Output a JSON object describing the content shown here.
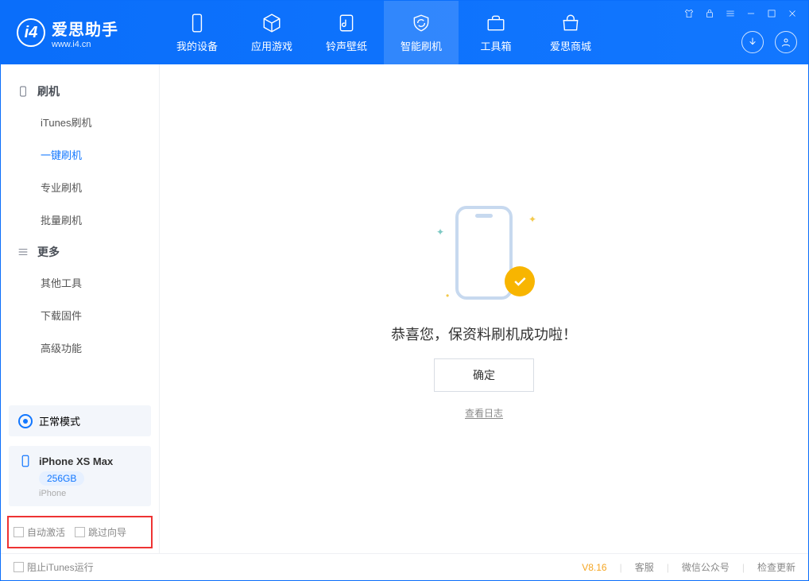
{
  "brand": {
    "cn": "爱思助手",
    "url": "www.i4.cn"
  },
  "tabs": [
    {
      "label": "我的设备"
    },
    {
      "label": "应用游戏"
    },
    {
      "label": "铃声壁纸"
    },
    {
      "label": "智能刷机"
    },
    {
      "label": "工具箱"
    },
    {
      "label": "爱思商城"
    }
  ],
  "sidebar": {
    "group1": {
      "title": "刷机",
      "items": [
        "iTunes刷机",
        "一键刷机",
        "专业刷机",
        "批量刷机"
      ]
    },
    "group2": {
      "title": "更多",
      "items": [
        "其他工具",
        "下载固件",
        "高级功能"
      ]
    }
  },
  "mode": {
    "label": "正常模式"
  },
  "device": {
    "name": "iPhone XS Max",
    "storage": "256GB",
    "type": "iPhone"
  },
  "checks": {
    "auto_activate": "自动激活",
    "skip_guide": "跳过向导"
  },
  "main": {
    "message": "恭喜您，保资料刷机成功啦！",
    "ok": "确定",
    "view_log": "查看日志"
  },
  "status": {
    "block_itunes": "阻止iTunes运行",
    "version": "V8.16",
    "cs": "客服",
    "wechat": "微信公众号",
    "update": "检查更新"
  }
}
